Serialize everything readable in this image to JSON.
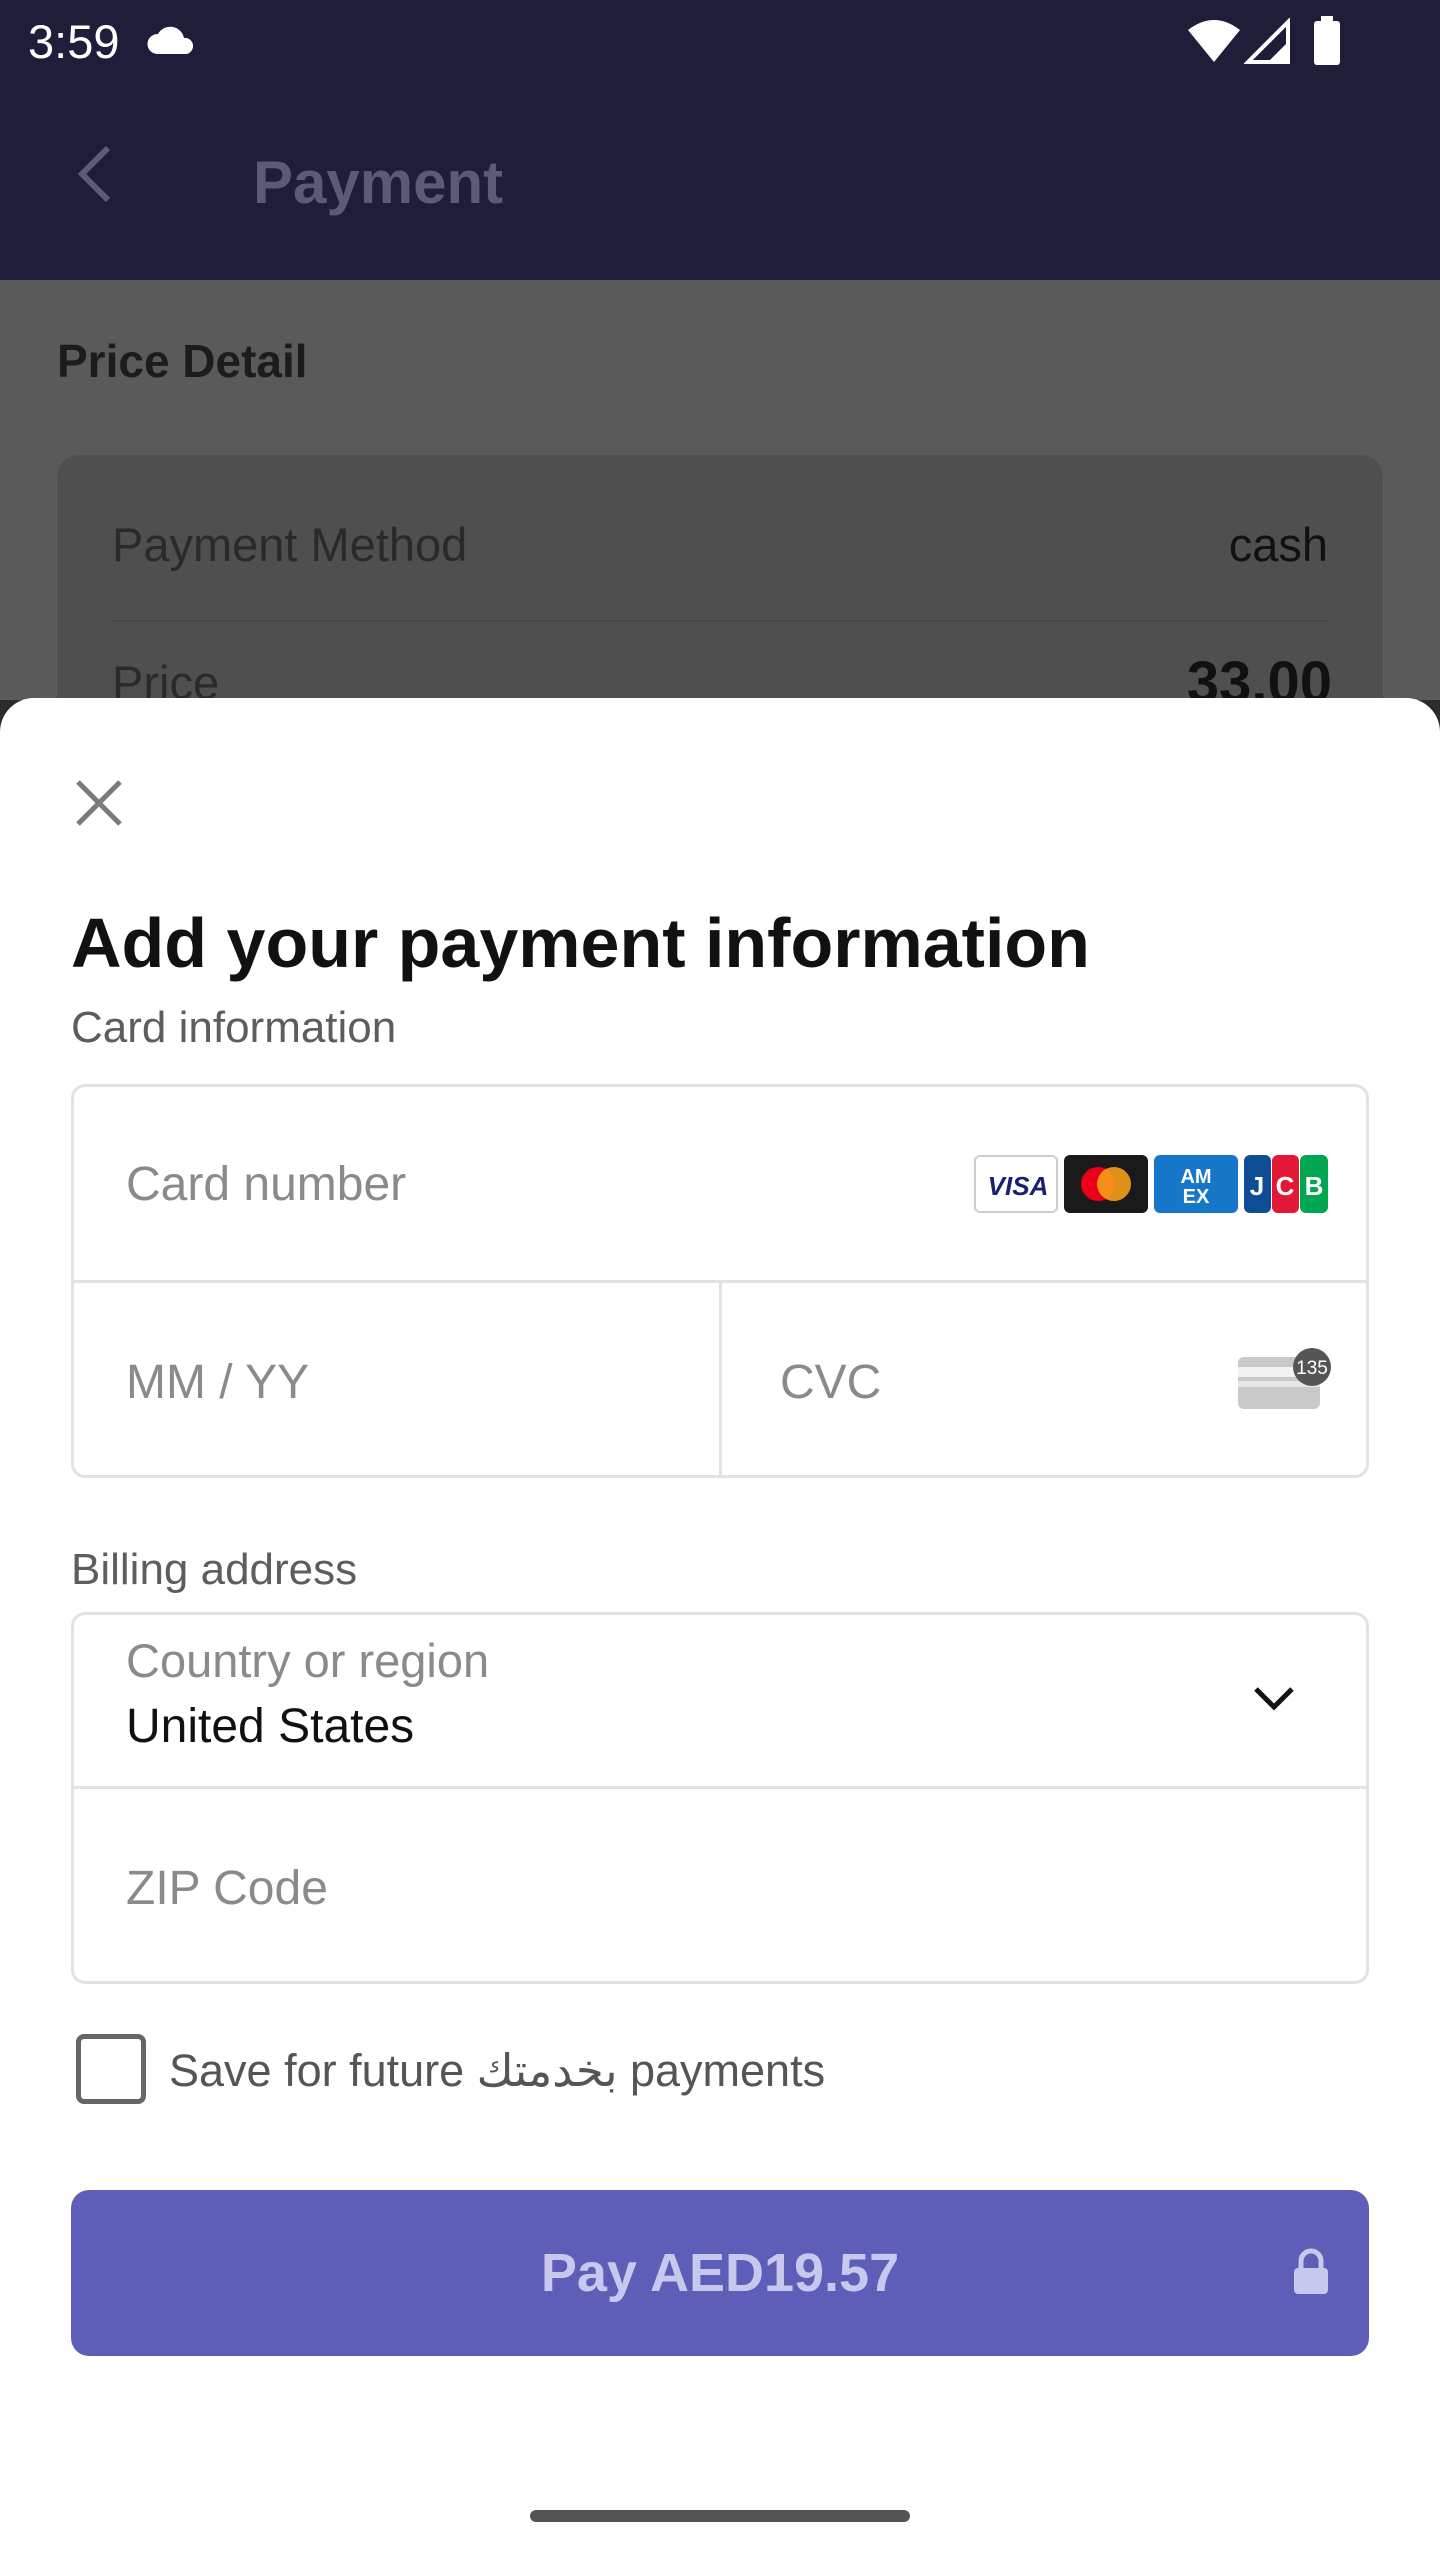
{
  "status_bar": {
    "time": "3:59",
    "icons": [
      "cloud-icon",
      "wifi-icon",
      "signal-icon",
      "battery-icon"
    ]
  },
  "app_bar": {
    "title": "Payment",
    "back_icon": "chevron-left-icon"
  },
  "background": {
    "section_title": "Price Detail",
    "payment_method_label": "Payment Method",
    "payment_method_value": "cash",
    "price_label_partial": "Price",
    "price_value_partial": "33.00"
  },
  "sheet": {
    "close_icon": "close-icon",
    "title": "Add your payment information",
    "card_info_label": "Card information",
    "card_number_placeholder": "Card number",
    "card_brands": [
      "VISA",
      "Mastercard",
      "AMEX",
      "JCB"
    ],
    "expiry_placeholder": "MM / YY",
    "cvc_placeholder": "CVC",
    "cvc_icon_badge": "135",
    "billing_label": "Billing address",
    "country_label": "Country or region",
    "country_value": "United States",
    "zip_placeholder": "ZIP Code",
    "save_label": "Save for future بخدمتك payments",
    "save_checked": false,
    "pay_label": "Pay AED19.57"
  },
  "colors": {
    "app_bar": "#1e1d3a",
    "pay_button": "#5e5eb8",
    "pay_text": "#c8c8ee"
  }
}
